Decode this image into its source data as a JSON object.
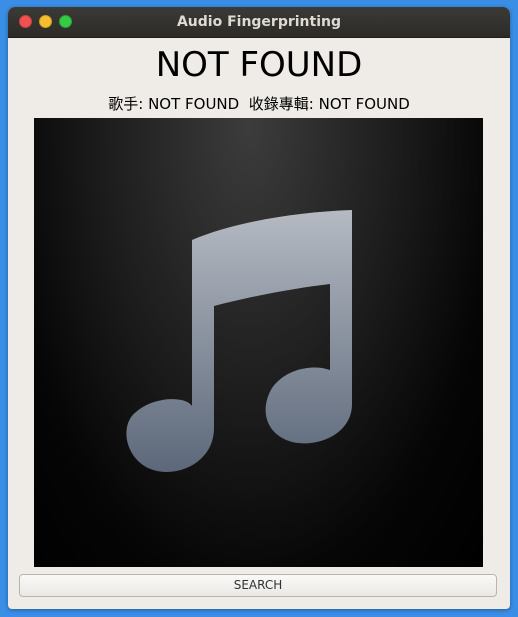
{
  "window": {
    "title": "Audio Fingerprinting"
  },
  "track": {
    "title": "NOT FOUND",
    "artist_label": "歌手:",
    "artist": "NOT FOUND",
    "album_label": "收錄專輯:",
    "album": "NOT FOUND"
  },
  "album_art": {
    "icon": "music-note-icon"
  },
  "actions": {
    "search_label": "SEARCH"
  },
  "colors": {
    "desktop_bg": "#3a8ee6",
    "window_bg": "#efebe6",
    "titlebar_bg": "#2c2b28",
    "note_top": "#b3b8c0",
    "note_bottom": "#5f6b7d"
  }
}
